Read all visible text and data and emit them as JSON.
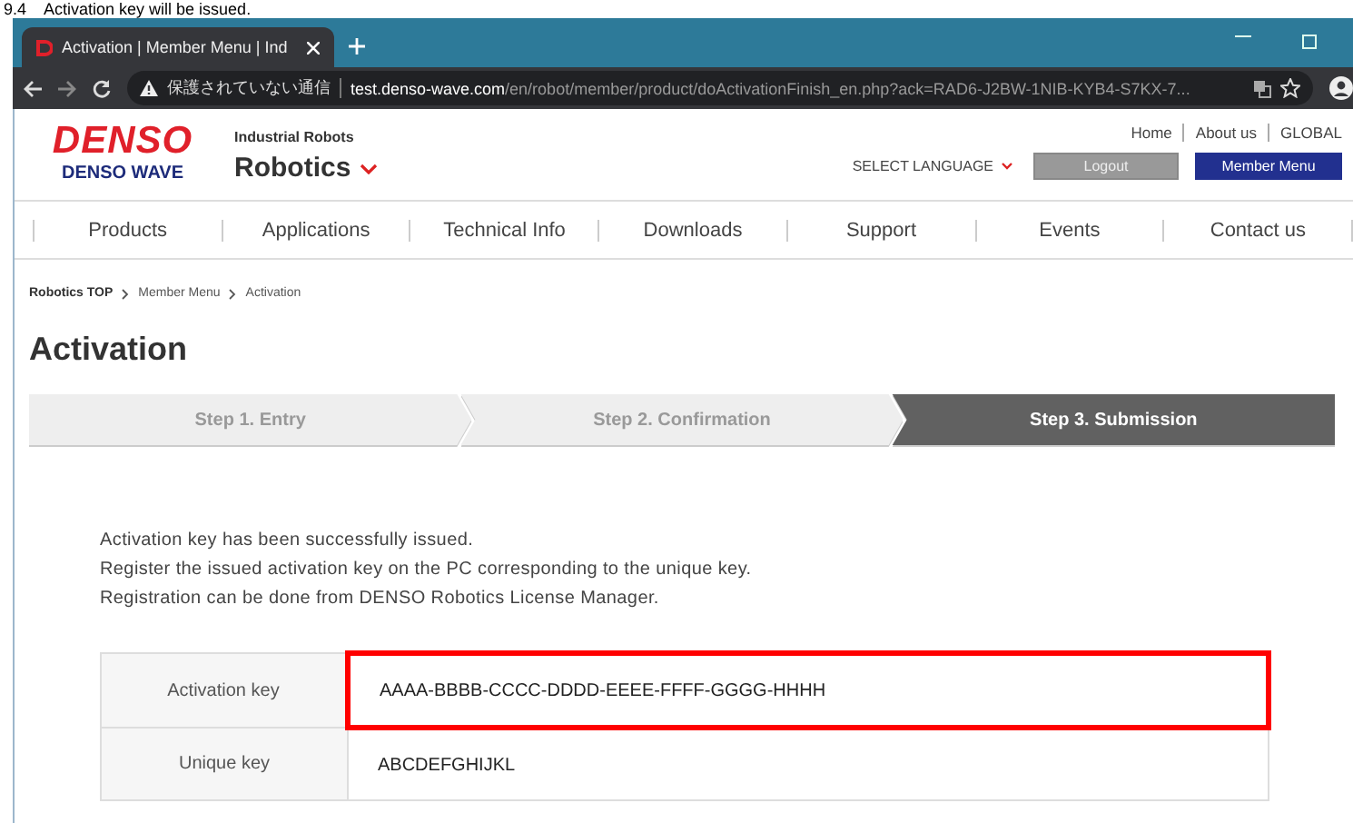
{
  "caption": "9.4    Activation key will be issued.",
  "browser": {
    "tabs": [
      {
        "label": "Activation | Member Menu | Ind",
        "selected": true
      }
    ],
    "address": {
      "security": "保護されていない通信",
      "host": "test.denso-wave.com",
      "path": "/en/robot/member/product/doActivationFinish_en.php?ack=RAD6-J2BW-1NIB-KYB4-S7KX-7..."
    }
  },
  "header": {
    "logo": "DENSO",
    "logo_sub": "DENSO WAVE",
    "category": "Industrial Robots",
    "site": "Robotics",
    "top_links": [
      "Home",
      "About us",
      "GLOBAL"
    ],
    "language": "SELECT LANGUAGE",
    "logout": "Logout",
    "member_menu": "Member Menu"
  },
  "nav": [
    "Products",
    "Applications",
    "Technical Info",
    "Downloads",
    "Support",
    "Events",
    "Contact us"
  ],
  "breadcrumb": [
    {
      "label": "Robotics TOP",
      "bold": true
    },
    {
      "label": "Member Menu",
      "bold": false
    },
    {
      "label": "Activation",
      "bold": false
    }
  ],
  "title": "Activation",
  "steps": [
    {
      "label": "Step 1. Entry",
      "selected": false
    },
    {
      "label": "Step 2. Confirmation",
      "selected": false
    },
    {
      "label": "Step 3. Submission",
      "selected": true
    }
  ],
  "messages": [
    "Activation key has been successfully issued.",
    "Register the issued activation key on the PC corresponding to the unique key.",
    "Registration can be done from DENSO Robotics License Manager."
  ],
  "table": [
    {
      "label": "Activation key",
      "value": "AAAA-BBBB-CCCC-DDDD-EEEE-FFFF-GGGG-HHHH",
      "highlighted": true
    },
    {
      "label": "Unique key",
      "value": "ABCDEFGHIJKL",
      "highlighted": false
    }
  ]
}
